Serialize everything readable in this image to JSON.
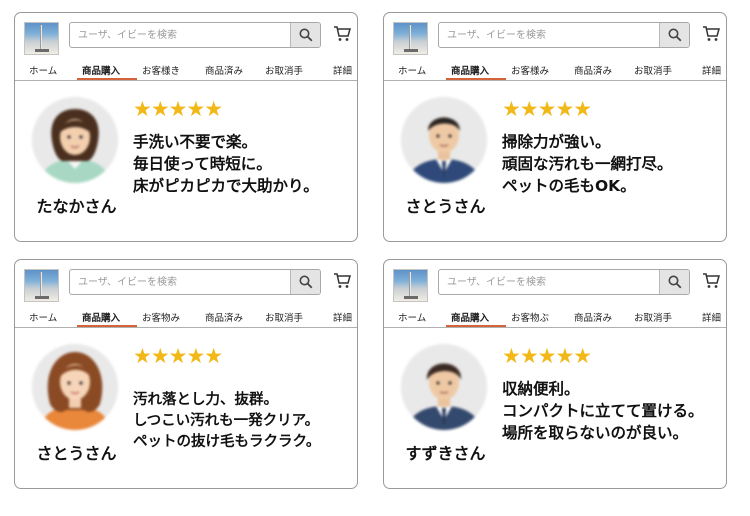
{
  "header": {
    "search_placeholder": "ユーザ、イビーを検索",
    "tabs": [
      [
        "ホーム",
        "商品購入",
        "お客様き",
        "商品済み",
        "お取消手",
        "詳細"
      ],
      [
        "ホーム",
        "商品購入",
        "お客様み",
        "商品済み",
        "お取消手",
        "詳細"
      ],
      [
        "ホーム",
        "商品購入",
        "お客物み",
        "商品済み",
        "お取消手",
        "詳細"
      ],
      [
        "ホーム",
        "商品購入",
        "お客物ぶ",
        "商品済み",
        "お取消手",
        "詳細"
      ]
    ]
  },
  "reviews": [
    {
      "name": "たなかさん",
      "stars": "★★★★★",
      "lines": [
        "手洗い不要で楽。",
        "毎日使って時短に。",
        "床がピカピカで大助かり。"
      ]
    },
    {
      "name": "さとうさん",
      "stars": "★★★★★",
      "lines": [
        "掃除力が強い。",
        "頑固な汚れも一網打尽。",
        "ペットの毛もOK。"
      ]
    },
    {
      "name": "さとうさん",
      "stars": "★★★★★",
      "lines": [
        "汚れ落とし力、抜群。",
        "しつこい汚れも一発クリア。",
        "ペットの抜け毛もラクラク。"
      ]
    },
    {
      "name": "すずきさん",
      "stars": "★★★★★",
      "lines": [
        "収納便利。",
        "コンパクトに立てて置ける。",
        "場所を取らないのが良い。"
      ]
    }
  ],
  "colors": {
    "accent": "#d4633a",
    "star": "#f2b818",
    "border": "#9a9a9a"
  },
  "icons": [
    "search-icon",
    "cart-icon"
  ]
}
